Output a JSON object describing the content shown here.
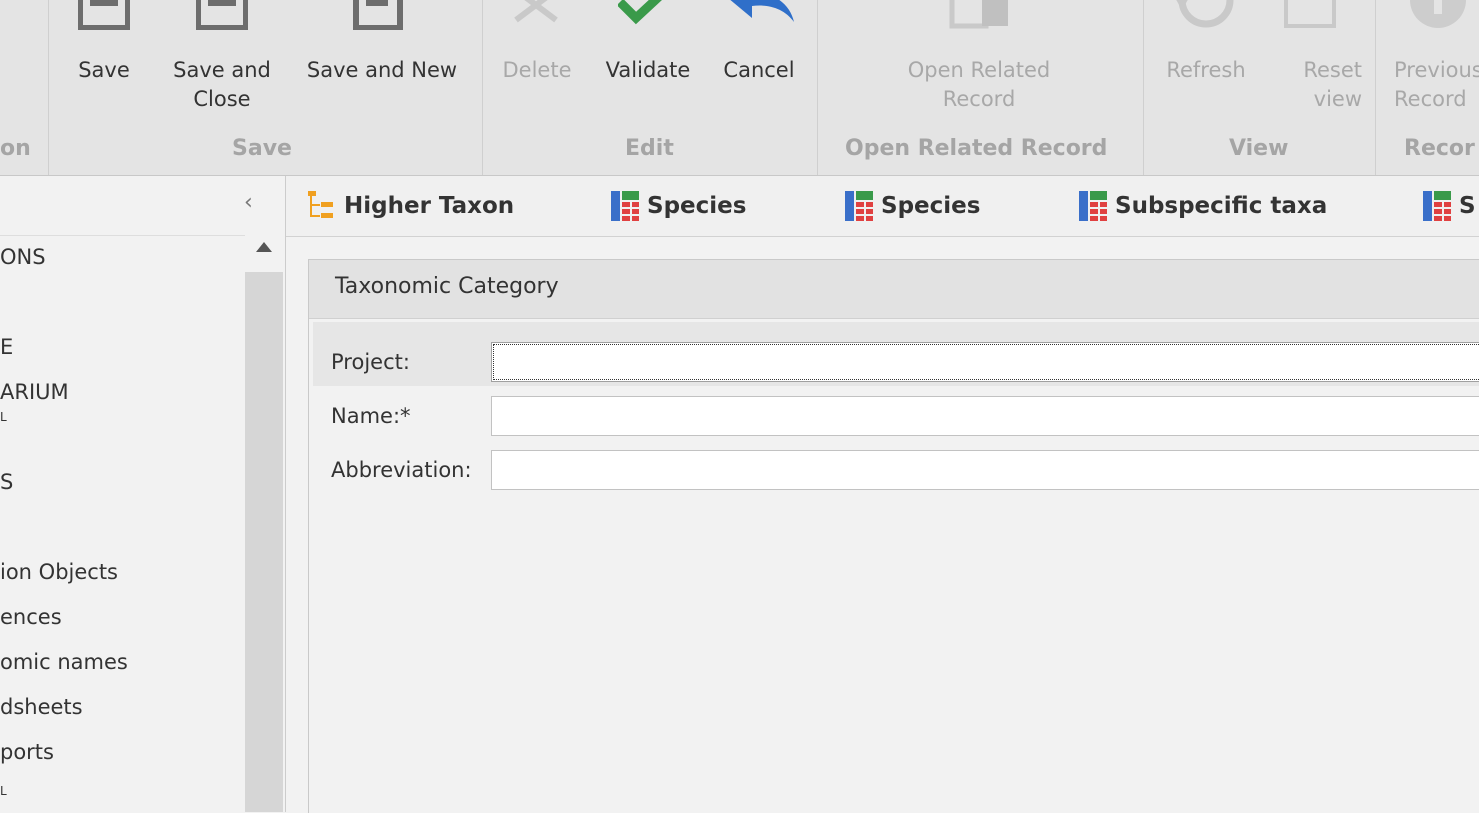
{
  "ribbon": {
    "groups": {
      "partial_left": "on",
      "save": "Save",
      "edit": "Edit",
      "open_related": "Open Related Record",
      "view": "View",
      "records": "Recor"
    },
    "buttons": {
      "save": "Save",
      "save_close_line1": "Save and",
      "save_close_line2": "Close",
      "save_new": "Save and New",
      "delete": "Delete",
      "validate": "Validate",
      "cancel": "Cancel",
      "open_related_line1": "Open Related",
      "open_related_line2": "Record",
      "refresh": "Refresh",
      "reset_line1": "Reset",
      "reset_line2": "view",
      "previous_line1": "Previous",
      "previous_line2": "Record"
    },
    "colors": {
      "validate_icon": "#3a9a4a",
      "cancel_icon": "#2f6fc9",
      "save_icon": "#6d6d6d",
      "disabled": "#a8a8a8"
    }
  },
  "sidebar": {
    "collapse_icon": "chevron-left-icon",
    "items": [
      "ONS",
      "E",
      "ARIUM",
      "L",
      "S",
      "ion Objects",
      "ences",
      "omic names",
      "dsheets",
      "ports",
      "L"
    ]
  },
  "tabs": [
    {
      "label": "Higher Taxon",
      "icon": "tree-icon"
    },
    {
      "label": "Species",
      "icon": "grid-icon"
    },
    {
      "label": "Species",
      "icon": "grid-icon"
    },
    {
      "label": "Subspecific taxa",
      "icon": "grid-icon"
    },
    {
      "label": "S",
      "icon": "grid-icon"
    }
  ],
  "form": {
    "title": "Taxonomic Category",
    "fields": [
      {
        "label": "Project:",
        "value": ""
      },
      {
        "label": "Name:*",
        "value": ""
      },
      {
        "label": "Abbreviation:",
        "value": ""
      }
    ]
  }
}
